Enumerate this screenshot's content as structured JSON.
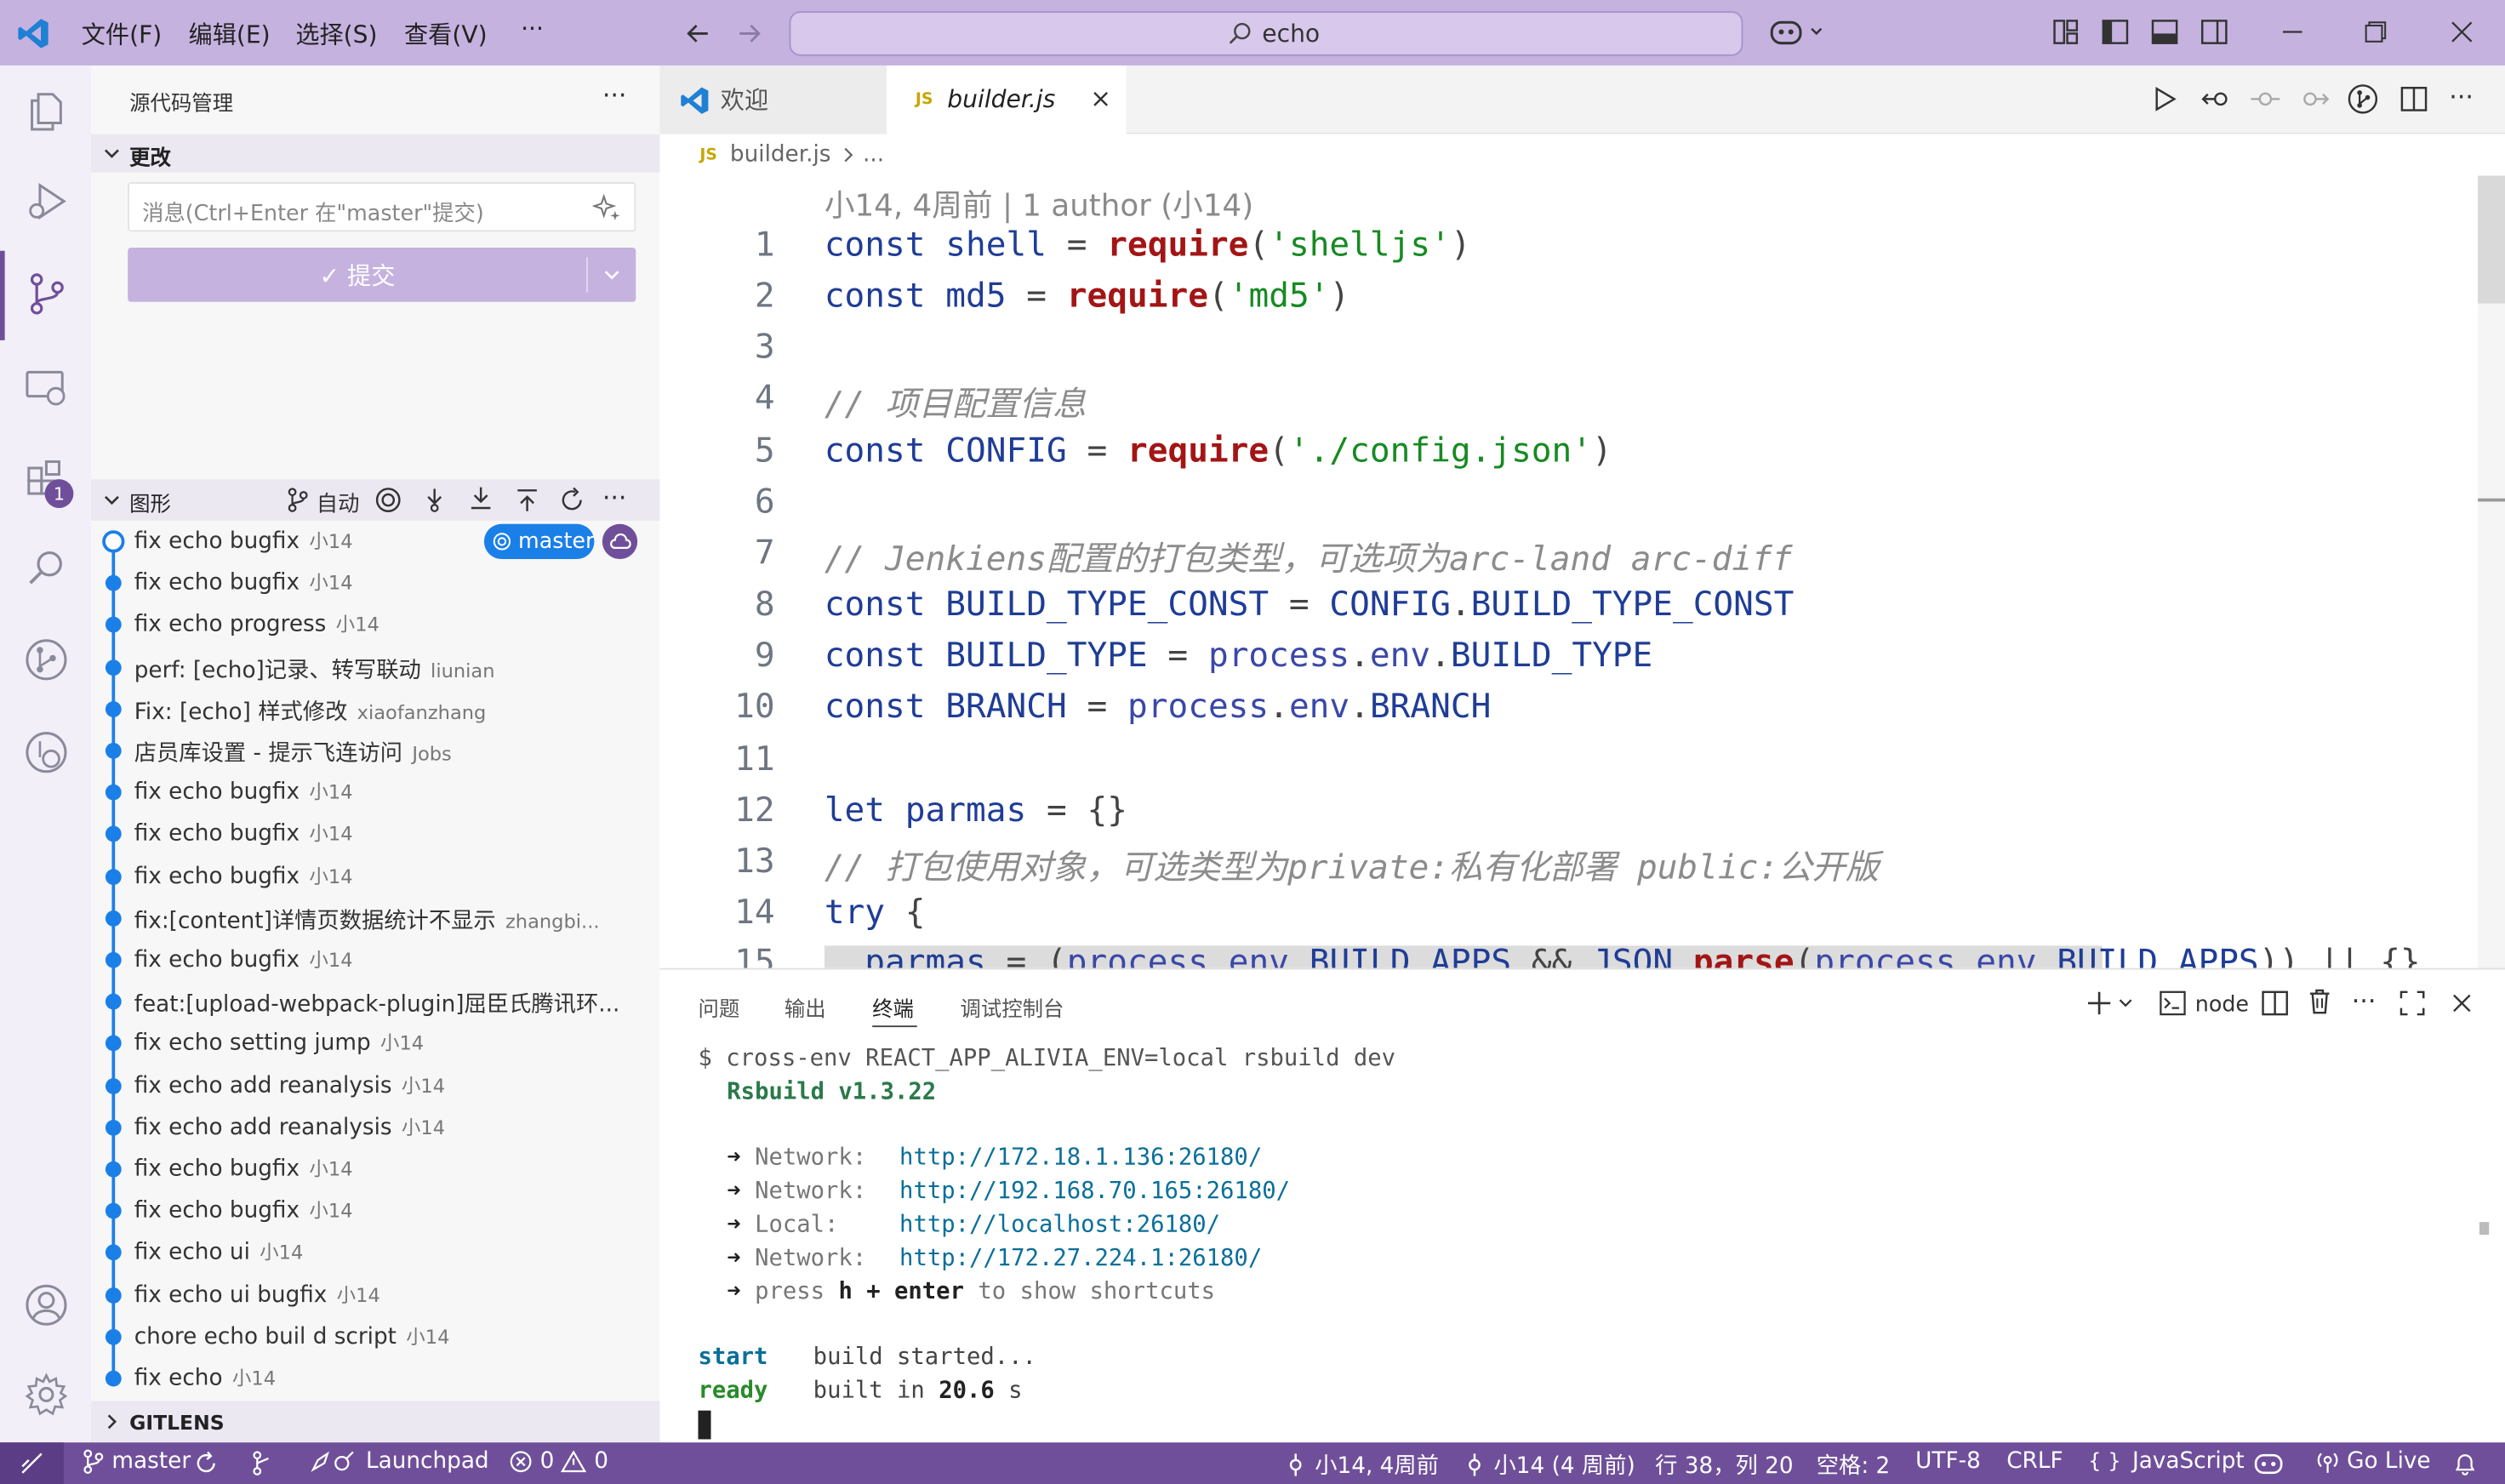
{
  "titlebar": {
    "menus": [
      "文件(F)",
      "编辑(E)",
      "选择(S)",
      "查看(V)",
      "···"
    ],
    "search_text": "echo"
  },
  "activity": {
    "extensions_badge": "1"
  },
  "scm": {
    "view_title": "源代码管理",
    "changes_header": "更改",
    "message_placeholder": "消息(Ctrl+Enter 在\"master\"提交)",
    "commit_label": "✓ 提交"
  },
  "graph": {
    "header": "图形",
    "auto_label": "自动",
    "branch_badge": "master",
    "commits": [
      {
        "msg": "fix echo bugfix",
        "author": "小14"
      },
      {
        "msg": "fix echo bugfix",
        "author": "小14"
      },
      {
        "msg": "fix echo progress",
        "author": "小14"
      },
      {
        "msg": "perf: [echo]记录、转写联动",
        "author": "liunian"
      },
      {
        "msg": "Fix: [echo] 样式修改",
        "author": "xiaofanzhang"
      },
      {
        "msg": "店员库设置 - 提示飞连访问",
        "author": "Jobs"
      },
      {
        "msg": "fix echo bugfix",
        "author": "小14"
      },
      {
        "msg": "fix echo bugfix",
        "author": "小14"
      },
      {
        "msg": "fix echo bugfix",
        "author": "小14"
      },
      {
        "msg": "fix:[content]详情页数据统计不显示",
        "author": "zhangbi..."
      },
      {
        "msg": "fix echo bugfix",
        "author": "小14"
      },
      {
        "msg": "feat:[upload-webpack-plugin]屈臣氏腾讯环...",
        "author": ""
      },
      {
        "msg": "fix echo setting jump",
        "author": "小14"
      },
      {
        "msg": "fix echo add reanalysis",
        "author": "小14"
      },
      {
        "msg": "fix echo add reanalysis",
        "author": "小14"
      },
      {
        "msg": "fix echo bugfix",
        "author": "小14"
      },
      {
        "msg": "fix echo bugfix",
        "author": "小14"
      },
      {
        "msg": "fix echo ui",
        "author": "小14"
      },
      {
        "msg": "fix echo ui bugfix",
        "author": "小14"
      },
      {
        "msg": "chore echo buil d script",
        "author": "小14"
      },
      {
        "msg": "fix echo",
        "author": "小14"
      }
    ],
    "gitlens_header": "GITLENS"
  },
  "tabs": [
    {
      "label": "欢迎"
    },
    {
      "label": "builder.js"
    }
  ],
  "breadcrumb": {
    "file": "builder.js",
    "more": "..."
  },
  "editor": {
    "blame": "小14, 4周前 | 1 author (小14)",
    "line_numbers": [
      "1",
      "2",
      "3",
      "4",
      "5",
      "6",
      "7",
      "8",
      "9",
      "10",
      "11",
      "12",
      "13",
      "14",
      "15"
    ]
  },
  "panel": {
    "tabs": [
      "问题",
      "输出",
      "终端",
      "调试控制台"
    ],
    "terminal_name": "node",
    "lines": {
      "cmd": "$ cross-env REACT_APP_ALIVIA_ENV=local rsbuild dev",
      "version": "Rsbuild v1.3.22",
      "n1_label": "Network:",
      "n1_url": "http://172.18.1.136:26180/",
      "n2_label": "Network:",
      "n2_url": "http://192.168.70.165:26180/",
      "n3_label": "Local:",
      "n3_url": "http://localhost:26180/",
      "n4_label": "Network:",
      "n4_url": "http://172.27.224.1:26180/",
      "press": "press",
      "key1": "h + enter",
      "press_tail": "to show shortcuts",
      "start_tag": "start",
      "start_msg": "build started...",
      "ready_tag": "ready",
      "ready_pre": "built in",
      "ready_time": "20.6",
      "ready_unit": "s"
    }
  },
  "status": {
    "branch": "master",
    "launchpad": "Launchpad",
    "errors": "0",
    "warnings": "0",
    "blame": "小14, 4周前",
    "author": "小14 (4 周前)",
    "position": "行 38，列 20",
    "spaces": "空格: 2",
    "encoding": "UTF-8",
    "eol": "CRLF",
    "language": "JavaScript",
    "golive": "Go Live"
  },
  "colors": {
    "titlebar": "#c5b2df",
    "statusbar": "#6f4f9a",
    "graph_dot": "#1b7fe8",
    "commit_button": "#c5b2df"
  }
}
